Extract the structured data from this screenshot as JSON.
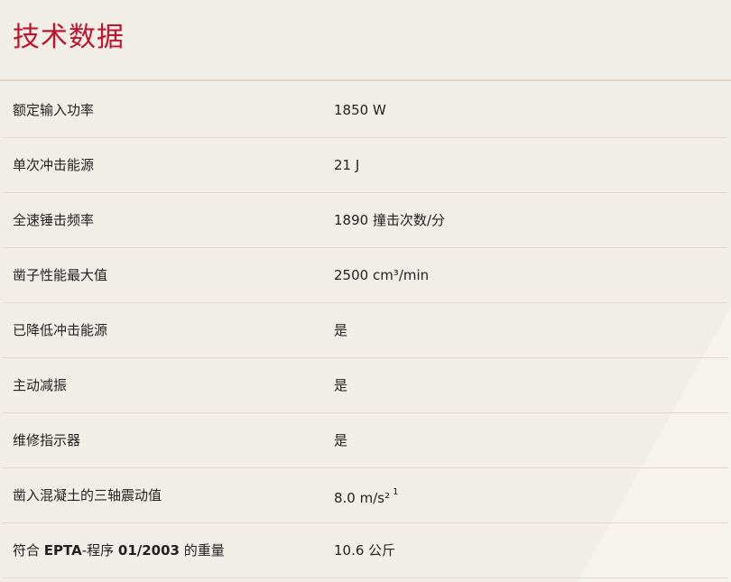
{
  "section": {
    "title": "技术数据"
  },
  "specs": [
    {
      "label": "额定输入功率",
      "value": "1850 W"
    },
    {
      "label": "单次冲击能源",
      "value": "21 J"
    },
    {
      "label": "全速锤击频率",
      "value": "1890 撞击次数/分"
    },
    {
      "label": "凿子性能最大值",
      "value": "2500 cm³/min"
    },
    {
      "label": "已降低冲击能源",
      "value": "是"
    },
    {
      "label": "主动减振",
      "value": "是"
    },
    {
      "label": "维修指示器",
      "value": "是"
    },
    {
      "label": "凿入混凝土的三轴震动值",
      "value": "8.0 m/s²",
      "footnote": "1"
    },
    {
      "label_prefix": "符合 ",
      "label_bold": "EPTA",
      "label_mid": "-程序 ",
      "label_bold2": "01/2003",
      "label_suffix": " 的重量",
      "value": "10.6 公斤"
    }
  ],
  "colors": {
    "title": "#c0132d",
    "background": "#f1eee8",
    "divider": "#e2d8cc"
  }
}
